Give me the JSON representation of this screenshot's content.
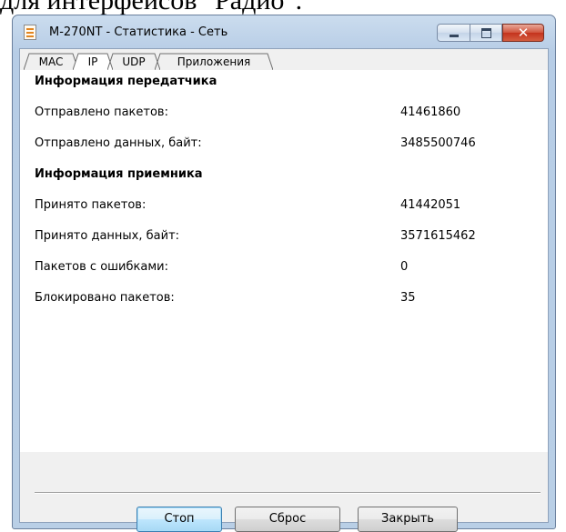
{
  "document": {
    "top_text": "для интерфейсов \"Радио\"."
  },
  "window": {
    "title": "M-270NT - Статистика - Сеть",
    "icon": "notepad-icon",
    "caption_buttons": [
      "minimize-icon",
      "maximize-icon",
      "close-icon"
    ]
  },
  "tabs": [
    {
      "label": "MAC",
      "active": false
    },
    {
      "label": "IP",
      "active": true
    },
    {
      "label": "UDP",
      "active": false
    },
    {
      "label": "Приложения",
      "active": false
    }
  ],
  "transmitter": {
    "heading": "Информация передатчика",
    "rows": [
      {
        "label": "Отправлено пакетов:",
        "value": "41461860"
      },
      {
        "label": "Отправлено данных, байт:",
        "value": "3485500746"
      }
    ]
  },
  "receiver": {
    "heading": "Информация приемника",
    "rows": [
      {
        "label": "Принято пакетов:",
        "value": "41442051"
      },
      {
        "label": "Принято данных, байт:",
        "value": "3571615462"
      },
      {
        "label": "Пакетов с ошибками:",
        "value": "0"
      },
      {
        "label": "Блокировано пакетов:",
        "value": "35"
      }
    ]
  },
  "buttons": {
    "stop": "Стоп",
    "reset": "Сброс",
    "close": "Закрыть"
  },
  "colors": {
    "close_button": "#c4321c",
    "default_button_border": "#3c7fb1",
    "frame": "#b9cfe6"
  }
}
